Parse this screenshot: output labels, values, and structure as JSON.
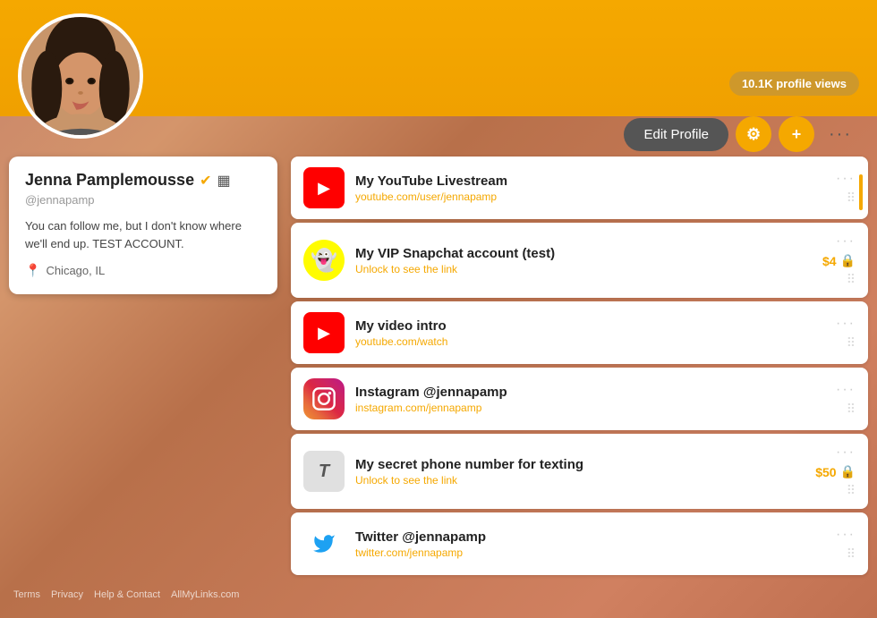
{
  "header": {
    "profile_views": "10.1K profile views",
    "edit_profile_label": "Edit Profile"
  },
  "action_bar": {
    "settings_icon": "gear-icon",
    "add_icon": "plus-icon",
    "more_icon": "ellipsis-icon"
  },
  "profile": {
    "name": "Jenna Pamplemousse",
    "handle": "@jennapamp",
    "bio": "You can follow me, but I don't know where we'll end up. TEST ACCOUNT.",
    "location": "Chicago, IL",
    "verified": true
  },
  "footer": {
    "links": [
      "Terms",
      "Privacy",
      "Help & Contact",
      "AllMyLinks.com"
    ]
  },
  "links": [
    {
      "id": "youtube-livestream",
      "icon_type": "youtube",
      "title": "My YouTube Livestream",
      "url": "youtube.com/user/jennapamp",
      "locked": false,
      "price": null
    },
    {
      "id": "snapchat-vip",
      "icon_type": "snapchat",
      "title": "My VIP Snapchat account (test)",
      "url": "Unlock to see the link",
      "locked": true,
      "price": "$4"
    },
    {
      "id": "video-intro",
      "icon_type": "youtube",
      "title": "My video intro",
      "url": "youtube.com/watch",
      "locked": false,
      "price": null
    },
    {
      "id": "instagram",
      "icon_type": "instagram",
      "title": "Instagram @jennapamp",
      "url": "instagram.com/jennapamp",
      "locked": false,
      "price": null
    },
    {
      "id": "phone-texting",
      "icon_type": "text",
      "title": "My secret phone number for texting",
      "url": "Unlock to see the link",
      "locked": true,
      "price": "$50"
    },
    {
      "id": "twitter",
      "icon_type": "twitter",
      "title": "Twitter @jennapamp",
      "url": "twitter.com/jennapamp",
      "locked": false,
      "price": null
    }
  ]
}
